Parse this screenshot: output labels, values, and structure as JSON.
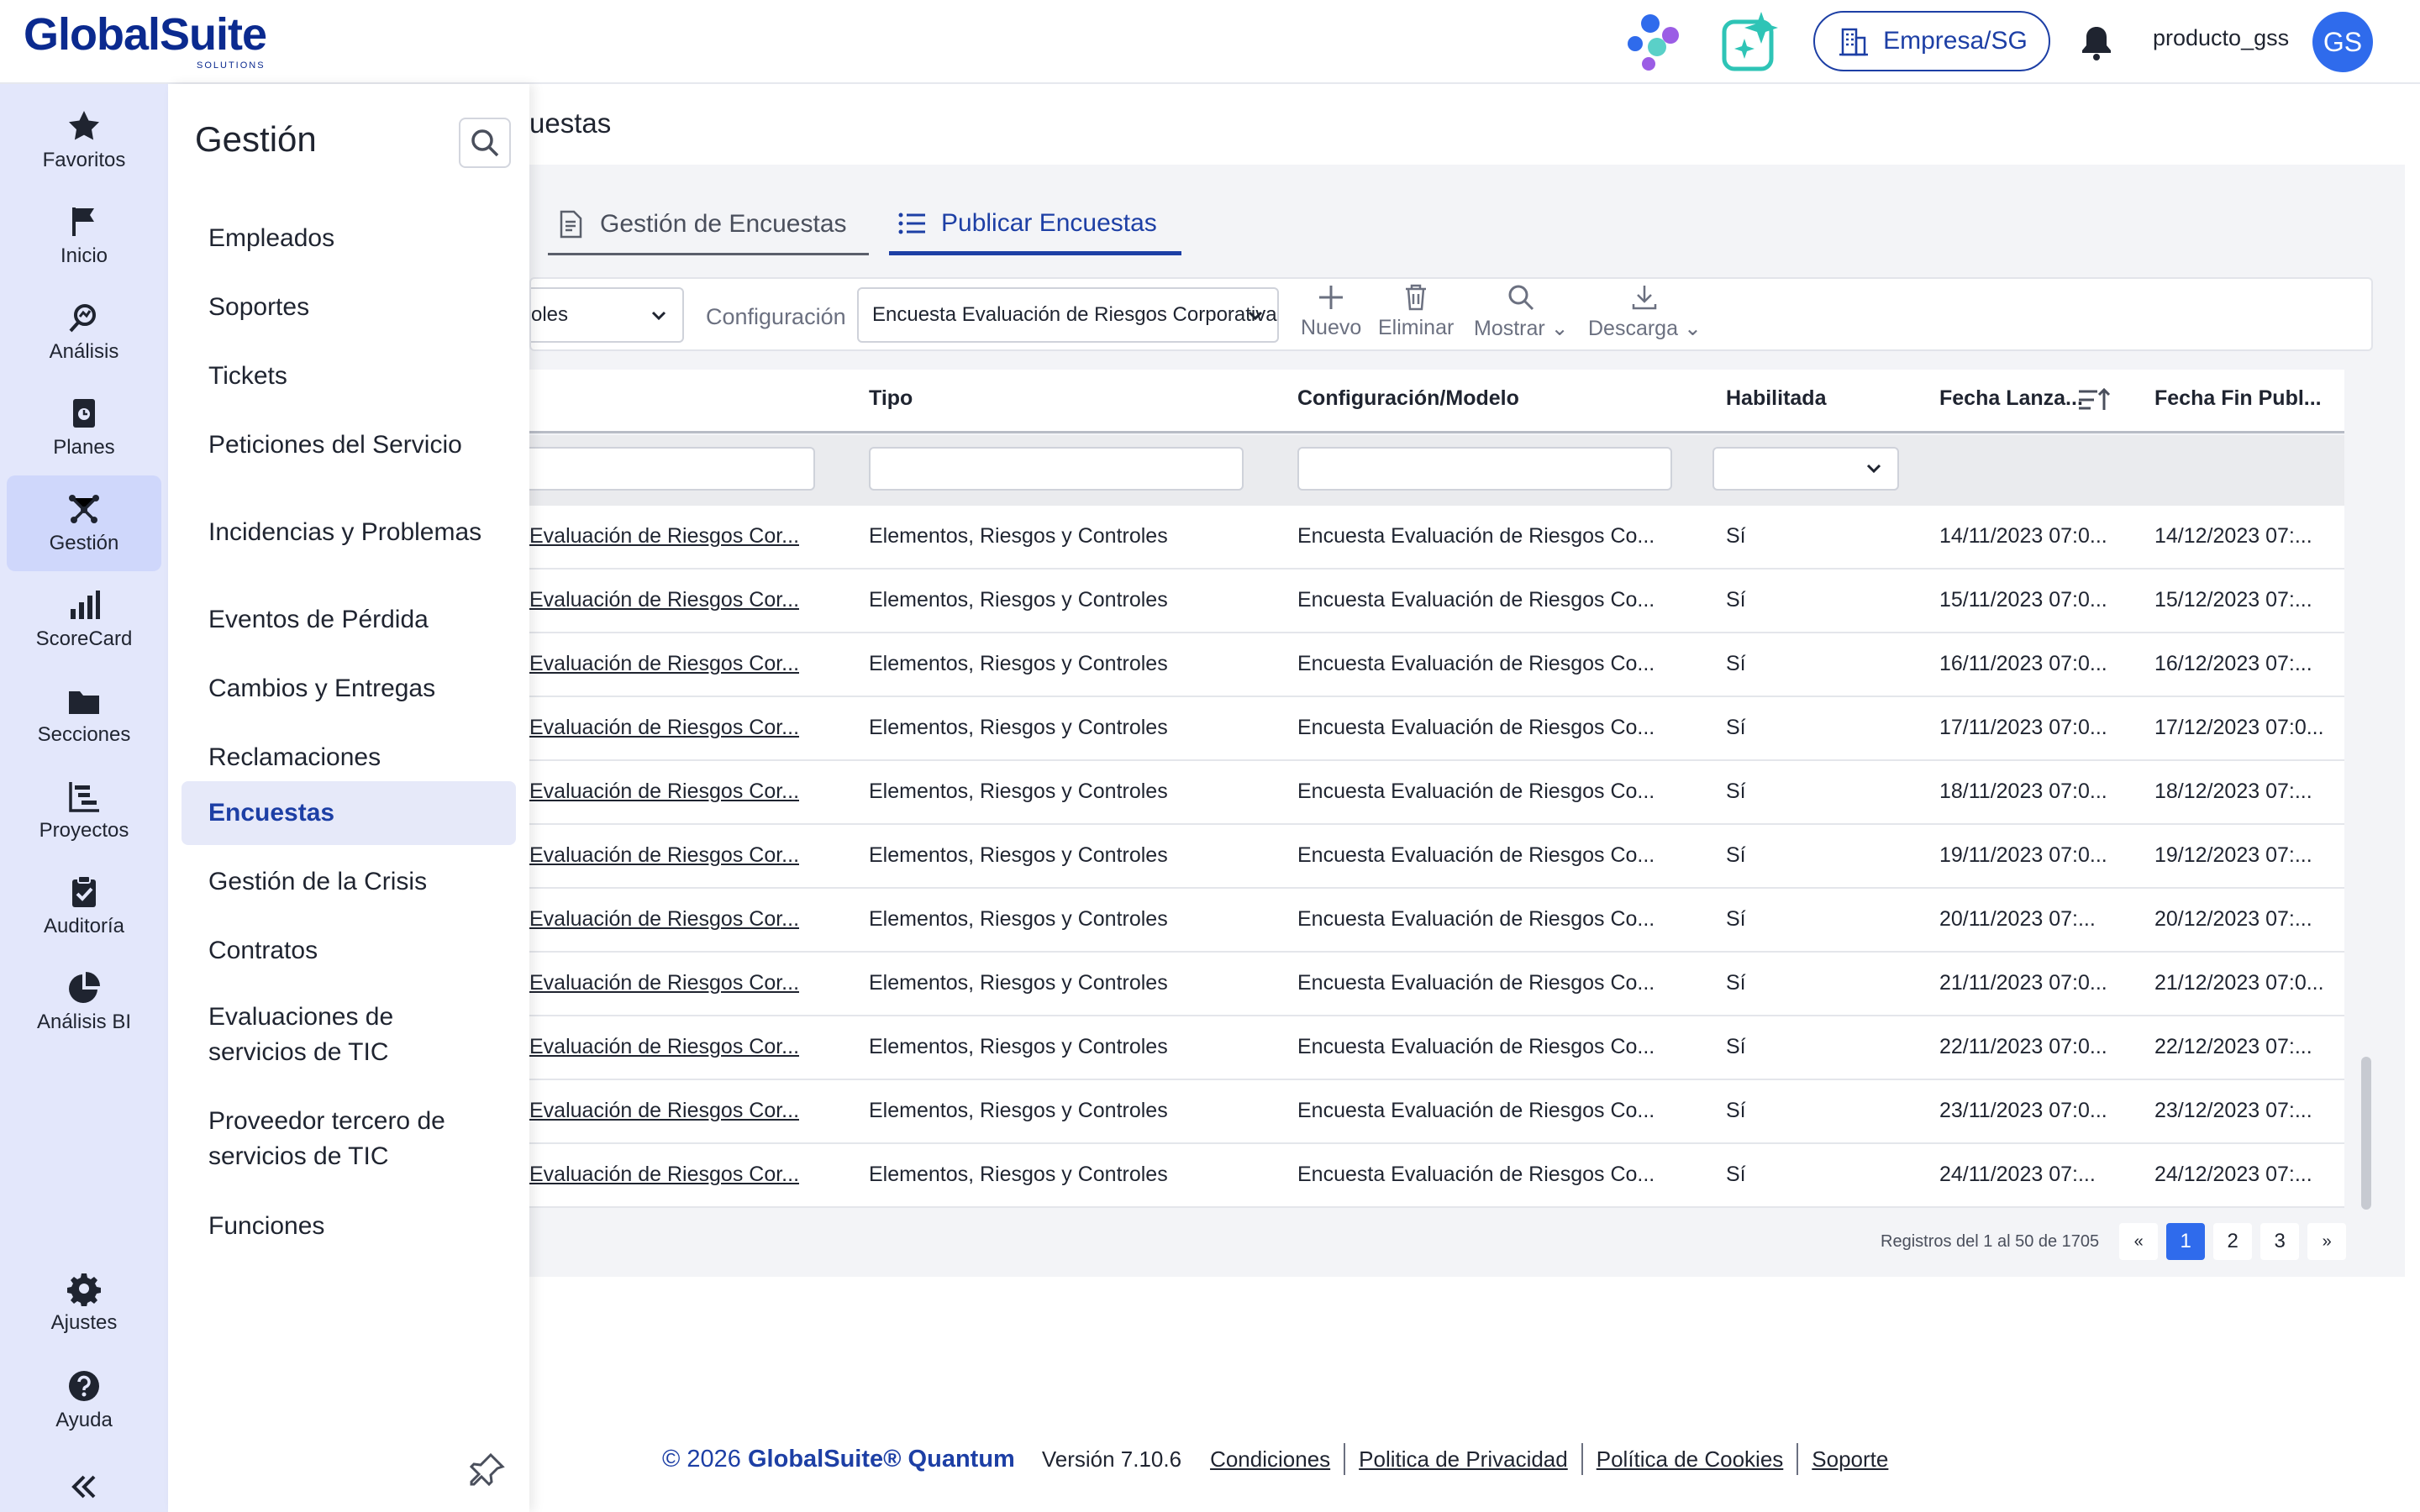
{
  "header": {
    "logo_text": "GlobalSuite",
    "logo_sub": "SOLUTIONS",
    "company": "Empresa/SG",
    "username": "producto_gss",
    "avatar_initials": "GS",
    "brand_color": "#1d3fa5"
  },
  "rail": {
    "items": [
      {
        "label": "Favoritos",
        "icon": "star-icon"
      },
      {
        "label": "Inicio",
        "icon": "flag-icon"
      },
      {
        "label": "Análisis",
        "icon": "analysis-icon"
      },
      {
        "label": "Planes",
        "icon": "plans-icon"
      },
      {
        "label": "Gestión",
        "icon": "network-icon",
        "active": true
      },
      {
        "label": "ScoreCard",
        "icon": "bar-chart-icon"
      },
      {
        "label": "Secciones",
        "icon": "folder-icon"
      },
      {
        "label": "Proyectos",
        "icon": "gantt-icon"
      },
      {
        "label": "Auditoría",
        "icon": "clipboard-check-icon"
      },
      {
        "label": "Análisis BI",
        "icon": "pie-chart-icon"
      }
    ],
    "settings": "Ajustes",
    "help": "Ayuda"
  },
  "panel": {
    "title": "Gestión",
    "items": [
      {
        "label": "Empleados"
      },
      {
        "label": "Soportes"
      },
      {
        "label": "Tickets"
      },
      {
        "label": "Peticiones del Servicio"
      },
      {
        "label": "Incidencias y Problemas"
      },
      {
        "label": "Eventos de Pérdida"
      },
      {
        "label": "Cambios y Entregas"
      },
      {
        "label": "Reclamaciones"
      },
      {
        "label": "Encuestas",
        "active": true
      },
      {
        "label": "Gestión de la Crisis"
      },
      {
        "label": "Contratos"
      },
      {
        "label": "Evaluaciones de servicios de TIC"
      },
      {
        "label": "Proveedor tercero de servicios de TIC"
      },
      {
        "label": "Funciones"
      }
    ]
  },
  "page": {
    "title": "uestas",
    "tabs": [
      {
        "label": "Gestión de Encuestas"
      },
      {
        "label": "Publicar Encuestas",
        "active": true
      }
    ]
  },
  "toolbar": {
    "filter_value": "oles",
    "config_label": "Configuración",
    "config_value": "Encuesta Evaluación de Riesgos Corporativa",
    "nuevo": "Nuevo",
    "eliminar": "Eliminar",
    "mostrar": "Mostrar",
    "descarga": "Descarga"
  },
  "table": {
    "columns": [
      "Tipo",
      "Configuración/Modelo",
      "Habilitada",
      "Fecha Lanza...",
      "Fecha Fin Publ..."
    ],
    "rows": [
      {
        "name": " Evaluación de Riesgos Cor...",
        "tipo": "Elementos, Riesgos y Controles",
        "config": "Encuesta Evaluación de Riesgos Co...",
        "hab": "Sí",
        "fl": "14/11/2023 07:0...",
        "ff": "14/12/2023 07:..."
      },
      {
        "name": " Evaluación de Riesgos Cor...",
        "tipo": "Elementos, Riesgos y Controles",
        "config": "Encuesta Evaluación de Riesgos Co...",
        "hab": "Sí",
        "fl": "15/11/2023 07:0...",
        "ff": "15/12/2023 07:..."
      },
      {
        "name": " Evaluación de Riesgos Cor...",
        "tipo": "Elementos, Riesgos y Controles",
        "config": "Encuesta Evaluación de Riesgos Co...",
        "hab": "Sí",
        "fl": "16/11/2023 07:0...",
        "ff": "16/12/2023 07:..."
      },
      {
        "name": " Evaluación de Riesgos Cor...",
        "tipo": "Elementos, Riesgos y Controles",
        "config": "Encuesta Evaluación de Riesgos Co...",
        "hab": "Sí",
        "fl": "17/11/2023 07:0...",
        "ff": "17/12/2023 07:0..."
      },
      {
        "name": " Evaluación de Riesgos Cor...",
        "tipo": "Elementos, Riesgos y Controles",
        "config": "Encuesta Evaluación de Riesgos Co...",
        "hab": "Sí",
        "fl": "18/11/2023 07:0...",
        "ff": "18/12/2023 07:..."
      },
      {
        "name": " Evaluación de Riesgos Cor...",
        "tipo": "Elementos, Riesgos y Controles",
        "config": "Encuesta Evaluación de Riesgos Co...",
        "hab": "Sí",
        "fl": "19/11/2023 07:0...",
        "ff": "19/12/2023 07:..."
      },
      {
        "name": " Evaluación de Riesgos Cor...",
        "tipo": "Elementos, Riesgos y Controles",
        "config": "Encuesta Evaluación de Riesgos Co...",
        "hab": "Sí",
        "fl": "20/11/2023 07:...",
        "ff": "20/12/2023 07:..."
      },
      {
        "name": " Evaluación de Riesgos Cor...",
        "tipo": "Elementos, Riesgos y Controles",
        "config": "Encuesta Evaluación de Riesgos Co...",
        "hab": "Sí",
        "fl": "21/11/2023 07:0...",
        "ff": "21/12/2023 07:0..."
      },
      {
        "name": " Evaluación de Riesgos Cor...",
        "tipo": "Elementos, Riesgos y Controles",
        "config": "Encuesta Evaluación de Riesgos Co...",
        "hab": "Sí",
        "fl": "22/11/2023 07:0...",
        "ff": "22/12/2023 07:..."
      },
      {
        "name": " Evaluación de Riesgos Cor...",
        "tipo": "Elementos, Riesgos y Controles",
        "config": "Encuesta Evaluación de Riesgos Co...",
        "hab": "Sí",
        "fl": "23/11/2023 07:0...",
        "ff": "23/12/2023 07:..."
      },
      {
        "name": " Evaluación de Riesgos Cor...",
        "tipo": "Elementos, Riesgos y Controles",
        "config": "Encuesta Evaluación de Riesgos Co...",
        "hab": "Sí",
        "fl": "24/11/2023 07:...",
        "ff": "24/12/2023 07:..."
      }
    ]
  },
  "pagination": {
    "records_text": "Registros del 1 al 50 de 1705",
    "first": "«",
    "pages": [
      "1",
      "2",
      "3"
    ],
    "current": "1",
    "last": "»"
  },
  "footer": {
    "copyright_prefix": "© 2026 ",
    "copyright_brand": "GlobalSuite® Quantum",
    "version": "Versión 7.10.6",
    "links": [
      "Condiciones",
      "Politica de Privacidad",
      "Política de Cookies",
      "Soporte"
    ]
  }
}
